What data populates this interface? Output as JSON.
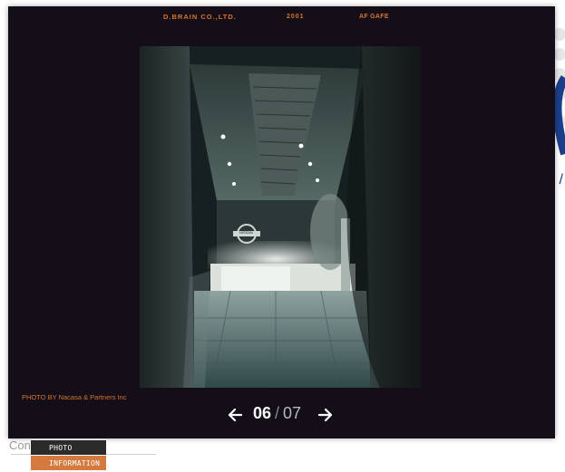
{
  "header": {
    "company": "D.BRAIN CO.,LTD.",
    "year": "2001",
    "project": "AF GAFE"
  },
  "photo": {
    "sign_text": "NISSAN"
  },
  "credit": "PHOTO BY Nacasa & Partners Inc",
  "nav": {
    "current": "06",
    "separator": "/",
    "total": "07"
  },
  "background_page": {
    "content_label": "Con",
    "slash_mark": "/",
    "small_mark": "("
  },
  "menu": {
    "photo_label": "PHOTO",
    "information_label": "INFORMATION"
  },
  "colors": {
    "accent": "#d9752b",
    "lightbox_bg": "#130e18",
    "info_tab": "#d47a3f",
    "photo_tab": "#2b2b2b"
  }
}
